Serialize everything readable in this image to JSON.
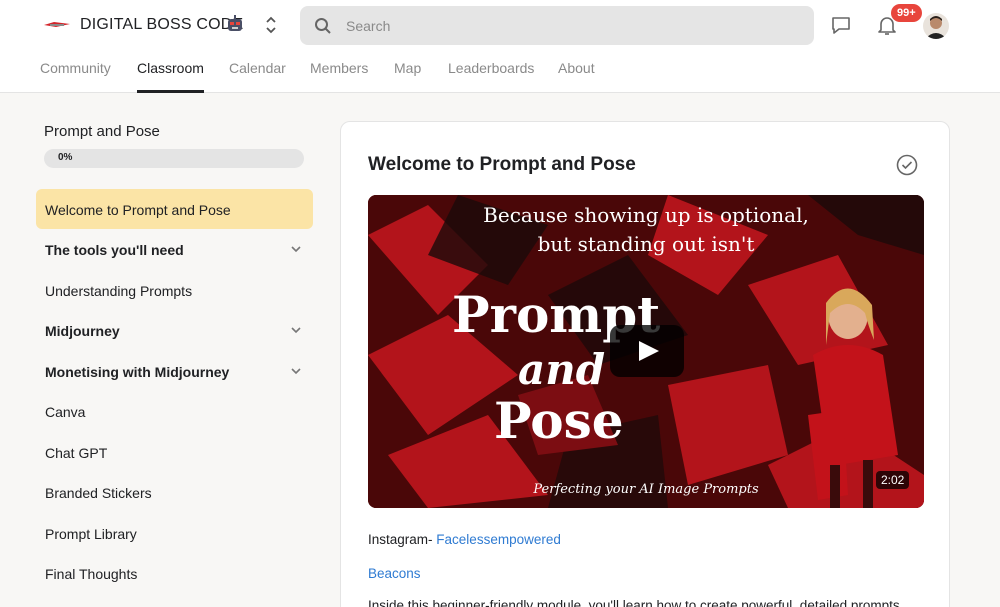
{
  "header": {
    "brand": "DIGITAL BOSS CODE",
    "search_placeholder": "Search",
    "notification_badge": "99+",
    "tabs": [
      {
        "label": "Community",
        "active": false
      },
      {
        "label": "Classroom",
        "active": true
      },
      {
        "label": "Calendar",
        "active": false
      },
      {
        "label": "Members",
        "active": false
      },
      {
        "label": "Map",
        "active": false
      },
      {
        "label": "Leaderboards",
        "active": false
      },
      {
        "label": "About",
        "active": false
      }
    ]
  },
  "sidebar": {
    "course_title": "Prompt and Pose",
    "progress_percent": 0,
    "progress_label": "0%",
    "lessons": [
      {
        "label": "Welcome to Prompt and Pose",
        "active": true,
        "bold": false,
        "expandable": false
      },
      {
        "label": "The tools you'll need",
        "active": false,
        "bold": true,
        "expandable": true
      },
      {
        "label": "Understanding Prompts",
        "active": false,
        "bold": false,
        "expandable": false
      },
      {
        "label": "Midjourney",
        "active": false,
        "bold": true,
        "expandable": true
      },
      {
        "label": "Monetising with Midjourney",
        "active": false,
        "bold": true,
        "expandable": true
      },
      {
        "label": "Canva",
        "active": false,
        "bold": false,
        "expandable": false
      },
      {
        "label": "Chat GPT",
        "active": false,
        "bold": false,
        "expandable": false
      },
      {
        "label": "Branded Stickers",
        "active": false,
        "bold": false,
        "expandable": false
      },
      {
        "label": "Prompt Library",
        "active": false,
        "bold": false,
        "expandable": false
      },
      {
        "label": "Final Thoughts",
        "active": false,
        "bold": false,
        "expandable": false
      }
    ]
  },
  "main": {
    "lesson_title": "Welcome to Prompt and Pose",
    "video": {
      "tagline_line1": "Because showing up is optional,",
      "tagline_line2": "but standing out isn't",
      "title_word1": "Prompt",
      "title_word2": "and",
      "title_word3": "Pose",
      "footer": "Perfecting your AI Image Prompts",
      "duration": "2:02"
    },
    "instagram_label": "Instagram-",
    "instagram_link": "Facelessempowered",
    "beacons_link": "Beacons",
    "description": "Inside this beginner-friendly module, you'll learn how to create powerful, detailed prompts"
  },
  "colors": {
    "active_lesson_bg": "#fbe4a6",
    "link": "#2f7bd2",
    "badge": "#e8453c",
    "video_red": "#b3141b"
  },
  "icons": [
    "logo-icon",
    "robot-emoji-icon",
    "switcher-icon",
    "search-icon",
    "chat-icon",
    "bell-icon",
    "avatar",
    "chevron-down-icon",
    "check-circle-icon",
    "play-icon"
  ]
}
